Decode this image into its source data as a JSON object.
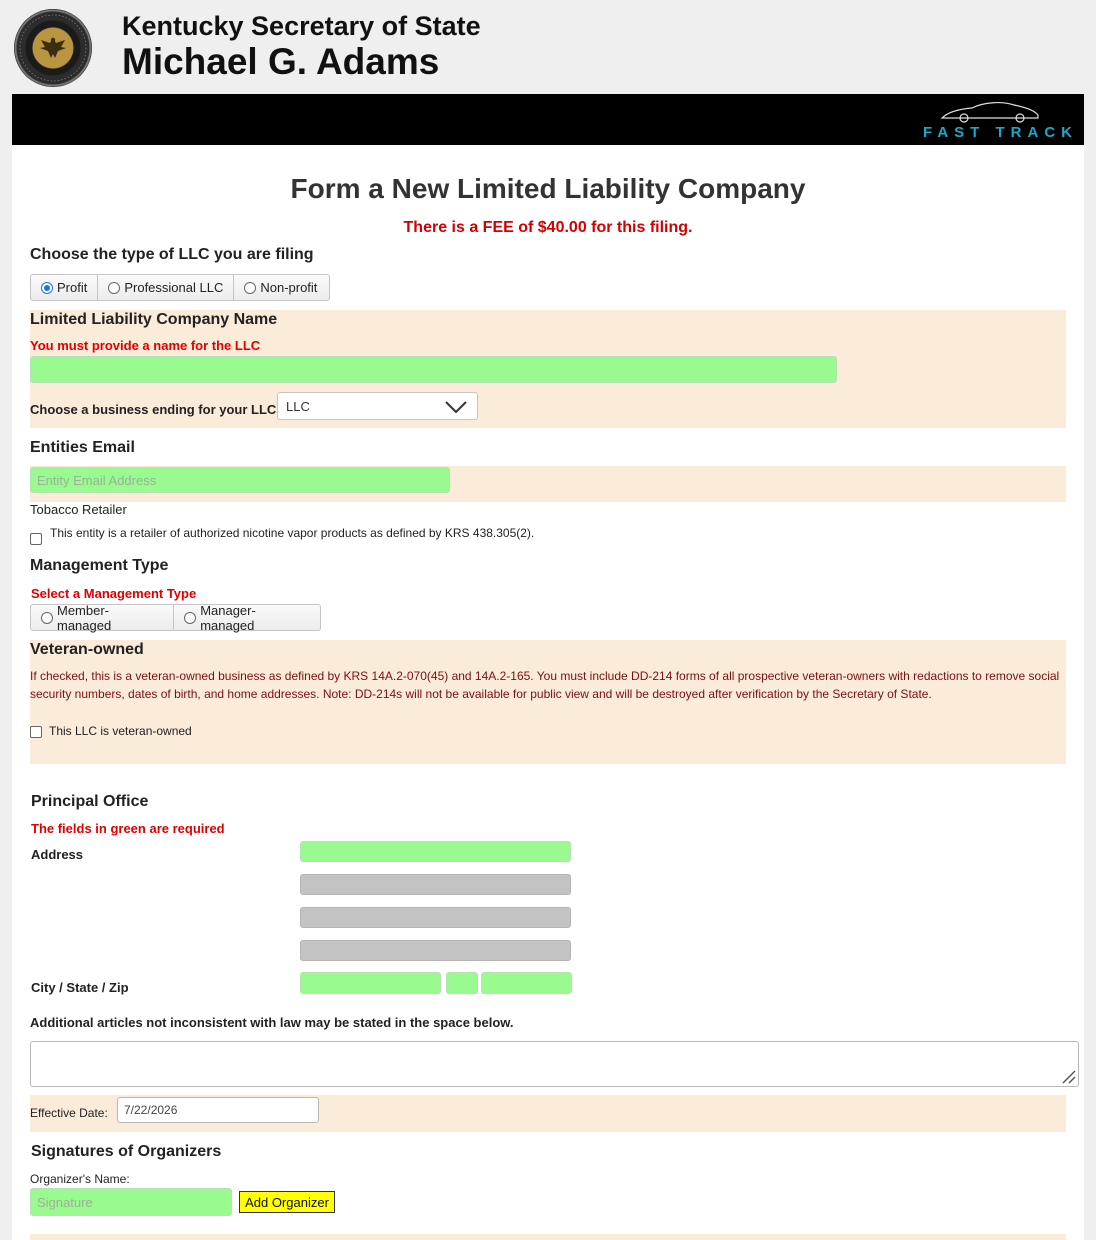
{
  "header": {
    "office": "Kentucky Secretary of State",
    "name": "Michael G. Adams",
    "banner_brand": "FAST TRACK"
  },
  "form": {
    "title": "Form a New Limited Liability Company",
    "fee": "There is a FEE of $40.00 for this filing."
  },
  "llc_type": {
    "title": "Choose the type of LLC you are filing",
    "options": [
      "Profit",
      "Professional LLC",
      "Non-profit"
    ],
    "selected": "Profit"
  },
  "company_name": {
    "title": "Limited Liability Company Name",
    "error": "You must provide a name for the LLC",
    "value": "",
    "ending_label": "Choose a business ending for your LLC",
    "ending_value": "LLC"
  },
  "email": {
    "title": "Entities Email",
    "placeholder": "Entity Email Address"
  },
  "tobacco": {
    "title": "Tobacco Retailer",
    "checkbox_label": "This entity is a retailer of authorized nicotine vapor products as defined by KRS 438.305(2)."
  },
  "management": {
    "title": "Management Type",
    "error": "Select a Management Type",
    "options": [
      "Member-managed",
      "Manager-managed"
    ]
  },
  "veteran": {
    "title": "Veteran-owned",
    "description": "If checked, this is a veteran-owned business as defined by KRS 14A.2-070(45) and 14A.2-165. You must include DD-214 forms of all prospective veteran-owners with redactions to remove social security numbers, dates of birth, and home addresses. Note: DD-214s will not be available for public view and will be destroyed after verification by the Secretary of State.",
    "checkbox_label": "This LLC is veteran-owned"
  },
  "principal_office": {
    "title": "Principal Office",
    "required_note": "The fields in green are required",
    "address_label": "Address",
    "city_label": "City / State / Zip"
  },
  "additional": {
    "label": "Additional articles not inconsistent with law may be stated in the space below."
  },
  "effective_date": {
    "label": "Effective Date:",
    "value": "7/22/2026"
  },
  "organizers": {
    "title": "Signatures of Organizers",
    "name_label": "Organizer's Name:",
    "placeholder": "Signature",
    "add_button": "Add Organizer"
  },
  "colors": {
    "required_field": "#99fa8f",
    "section_bg": "#fbebd9",
    "error_text": "#e00000",
    "banner_brand": "#1aa7c9",
    "add_button": "#ffff00"
  }
}
